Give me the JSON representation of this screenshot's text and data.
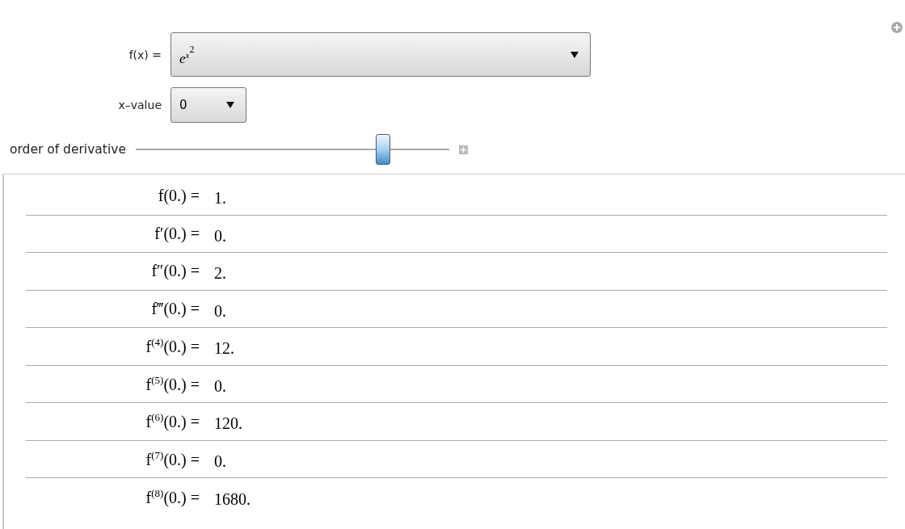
{
  "controls": {
    "function": {
      "label": "f(x) =",
      "value": {
        "base": "e",
        "exponent": "x",
        "exponent_power": "2"
      }
    },
    "x_value": {
      "label": "x–value",
      "value": "0"
    },
    "order": {
      "label": "order of derivative",
      "level": 0.79
    }
  },
  "results": [
    {
      "label": "f(0.) =",
      "value": "1."
    },
    {
      "label": "f′(0.) =",
      "value": "0."
    },
    {
      "label": "f″(0.) =",
      "value": "2."
    },
    {
      "label": "f‴(0.) =",
      "value": "0."
    },
    {
      "label": "f$^{(4)}$(0.) =",
      "value": "12."
    },
    {
      "label": "f$^{(5)}$(0.) =",
      "value": "0."
    },
    {
      "label": "f$^{(6)}$(0.) =",
      "value": "120."
    },
    {
      "label": "f$^{(7)}$(0.) =",
      "value": "0."
    },
    {
      "label": "f$^{(8)}$(0.) =",
      "value": "1680."
    }
  ]
}
